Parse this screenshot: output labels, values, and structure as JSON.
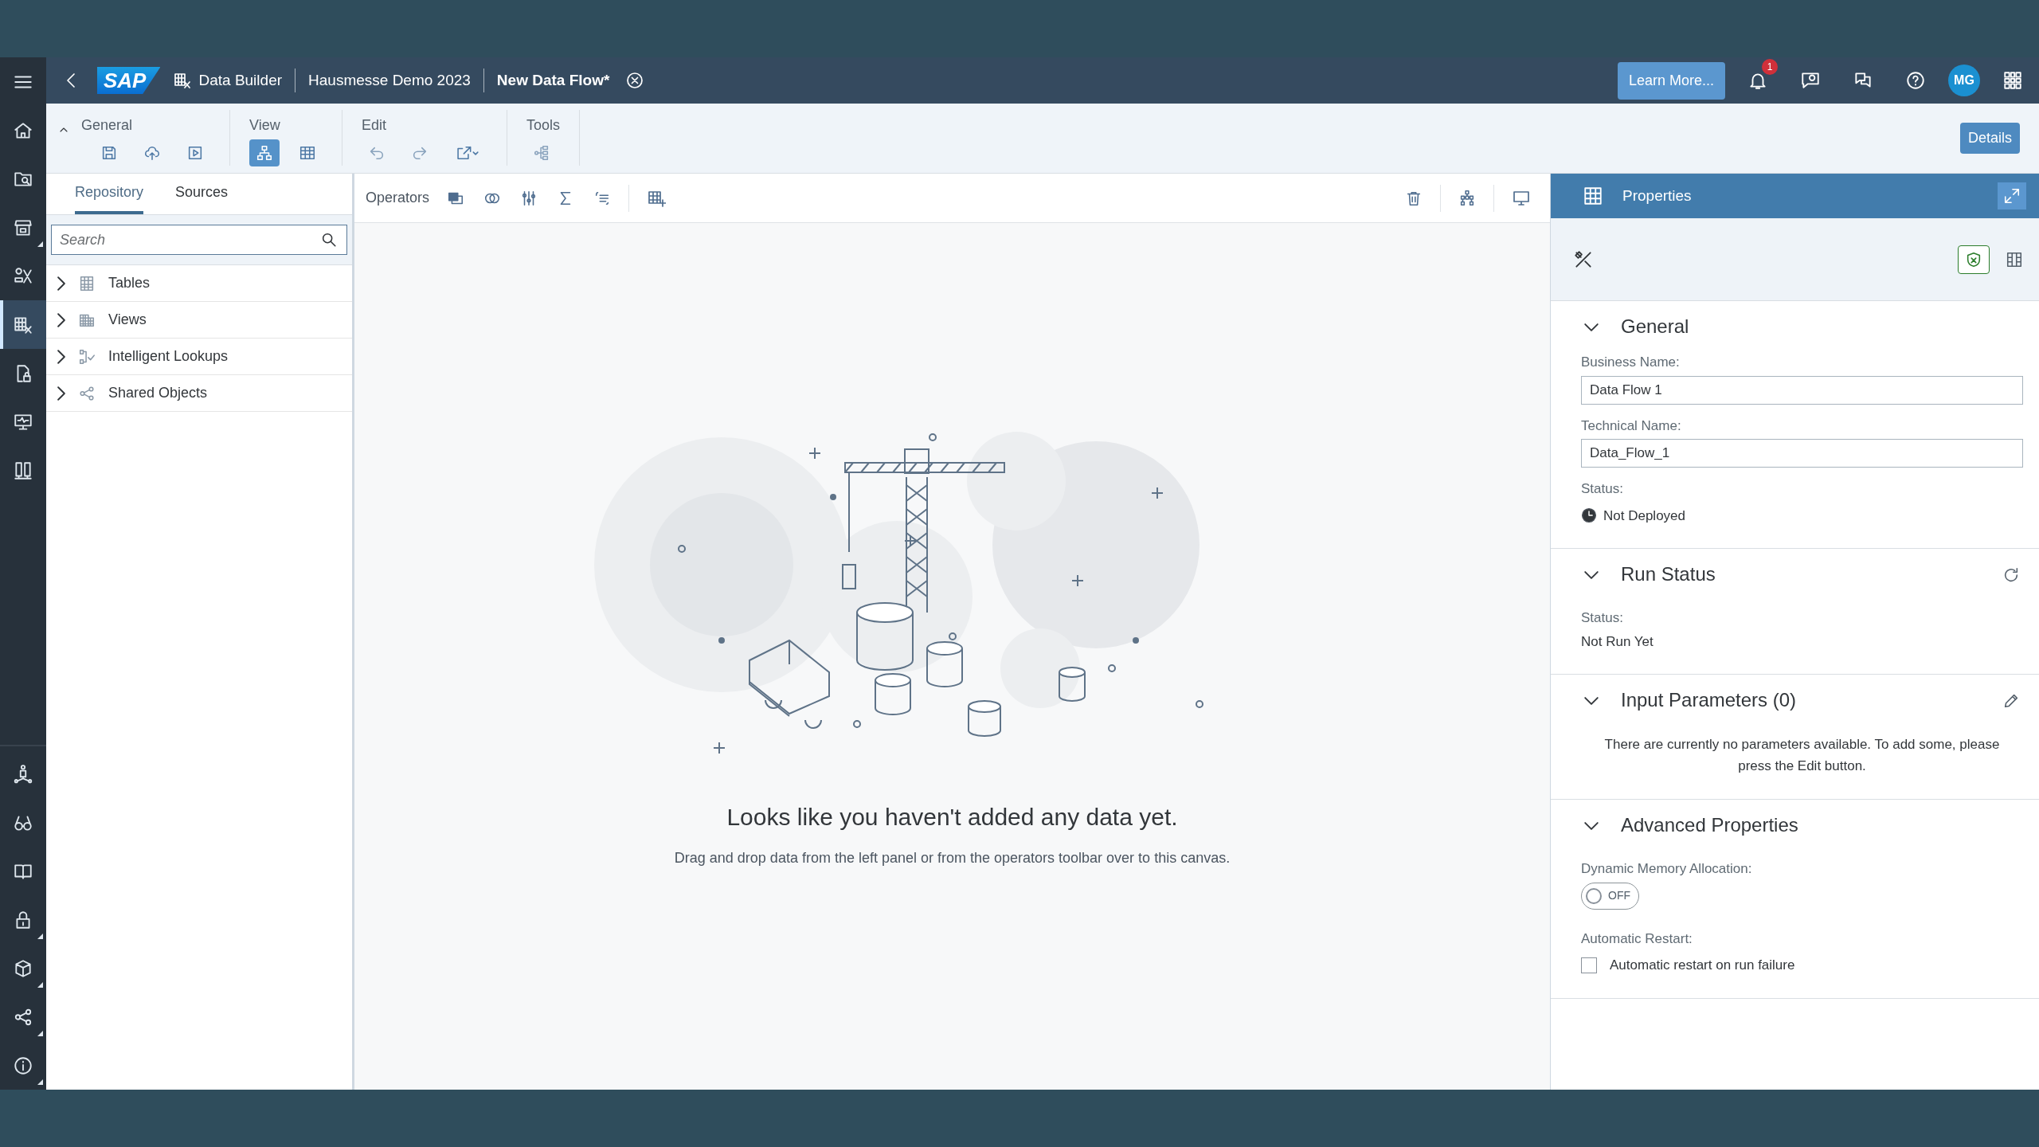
{
  "nav_rail": {
    "top": [
      {
        "selected": false,
        "submenu": false
      },
      {
        "selected": false,
        "submenu": false
      },
      {
        "selected": false,
        "submenu": false
      },
      {
        "selected": false,
        "submenu": true
      },
      {
        "selected": false,
        "submenu": false
      },
      {
        "selected": true,
        "submenu": false
      },
      {
        "selected": false,
        "submenu": false
      },
      {
        "selected": false,
        "submenu": false
      },
      {
        "selected": false,
        "submenu": false
      }
    ],
    "bottom": [
      {
        "selected": false,
        "submenu": false
      },
      {
        "selected": false,
        "submenu": false
      },
      {
        "selected": false,
        "submenu": false
      },
      {
        "selected": false,
        "submenu": true
      },
      {
        "selected": false,
        "submenu": true
      },
      {
        "selected": false,
        "submenu": true
      },
      {
        "selected": false,
        "submenu": true
      }
    ]
  },
  "shell": {
    "logo": "SAP",
    "breadcrumbs": [
      "Data Builder",
      "Hausmesse Demo 2023",
      "New Data Flow*"
    ],
    "learn_more": "Learn More...",
    "notification_count": "1",
    "avatar": "MG"
  },
  "toolbar": {
    "groups": [
      {
        "label": "General",
        "buttons": [
          {
            "selected": false,
            "disabled": false
          },
          {
            "selected": false,
            "disabled": false
          },
          {
            "selected": false,
            "disabled": false
          }
        ]
      },
      {
        "label": "View",
        "buttons": [
          {
            "selected": true,
            "disabled": false
          },
          {
            "selected": false,
            "disabled": false
          }
        ]
      },
      {
        "label": "Edit",
        "buttons": [
          {
            "selected": false,
            "disabled": true
          },
          {
            "selected": false,
            "disabled": true
          },
          {
            "selected": false,
            "disabled": false
          }
        ]
      },
      {
        "label": "Tools",
        "buttons": [
          {
            "selected": false,
            "disabled": true
          }
        ]
      }
    ],
    "details": "Details"
  },
  "left_panel": {
    "tabs": [
      {
        "label": "Repository",
        "selected": true
      },
      {
        "label": "Sources",
        "selected": false
      }
    ],
    "search": {
      "placeholder": "Search"
    },
    "tree": [
      {
        "label": "Tables",
        "expanded": false
      },
      {
        "label": "Views",
        "expanded": false
      },
      {
        "label": "Intelligent Lookups",
        "expanded": false
      },
      {
        "label": "Shared Objects",
        "expanded": false
      }
    ]
  },
  "canvas": {
    "operators_label": "Operators",
    "empty_title": "Looks like you haven't added any data yet.",
    "empty_text": "Drag and drop data from the left panel or from the operators toolbar over to this canvas."
  },
  "properties": {
    "title": "Properties",
    "sections": [
      {
        "kind": "general",
        "title": "General",
        "expanded": true,
        "fields": [
          {
            "label": "Business Name:",
            "value": "Data Flow 1"
          },
          {
            "label": "Technical Name:",
            "value": "Data_Flow_1"
          }
        ],
        "status_label": "Status:",
        "status": "Not Deployed"
      },
      {
        "kind": "run",
        "title": "Run Status",
        "expanded": true,
        "status_label": "Status:",
        "status": "Not Run Yet"
      },
      {
        "kind": "parameters",
        "title": "Input Parameters (0)",
        "expanded": true,
        "message": "There are currently no parameters available. To add some, please press the Edit button."
      },
      {
        "kind": "advanced",
        "title": "Advanced Properties",
        "expanded": true,
        "switch_label": "Dynamic Memory Allocation:",
        "switch": {
          "on": false,
          "text": "OFF"
        },
        "restart_label": "Automatic Restart:",
        "checkbox": {
          "label": "Automatic restart on run failure",
          "checked": false
        }
      }
    ]
  }
}
